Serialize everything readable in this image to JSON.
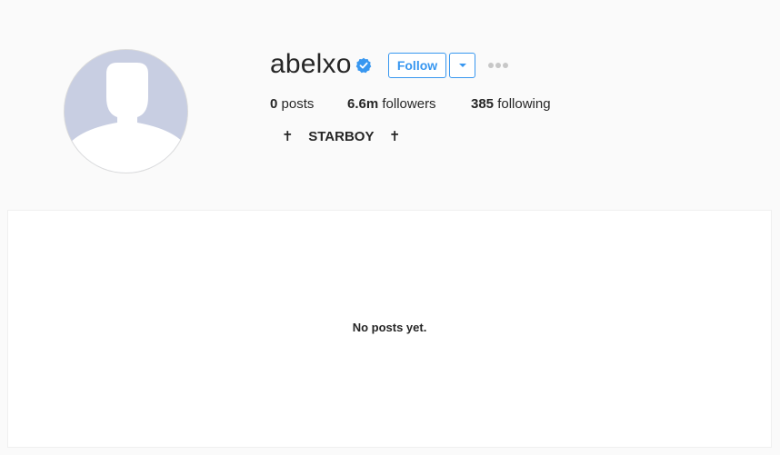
{
  "profile": {
    "username": "abelxo",
    "verified_icon": "verified-badge-icon",
    "follow_label": "Follow",
    "dropdown_icon": "caret-down-icon",
    "more_icon": "ellipsis-icon",
    "avatar_icon": "default-avatar-icon",
    "bio": "✝    STARBOY    ✝"
  },
  "stats": {
    "posts_count": "0",
    "posts_label": " posts",
    "followers_count": "6.6m",
    "followers_label": " followers",
    "following_count": "385",
    "following_label": " following"
  },
  "posts": {
    "empty_message": "No posts yet."
  },
  "colors": {
    "accent": "#3897f0",
    "background": "#fafafa",
    "text": "#262626",
    "avatar_bg": "#c8cee2",
    "more_dots": "#c7c7c7"
  }
}
